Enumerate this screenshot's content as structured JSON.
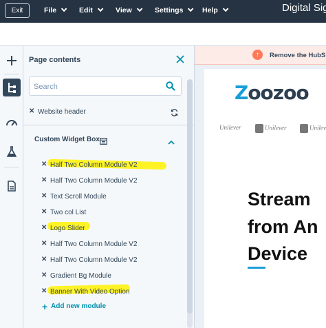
{
  "topbar": {
    "exit_label": "Exit",
    "menus": [
      "File",
      "Edit",
      "View",
      "Settings",
      "Help"
    ],
    "title": "Digital Sig"
  },
  "rail": {
    "icons": [
      "add-icon",
      "tree-icon",
      "gauge-icon",
      "flask-icon",
      "document-icon"
    ]
  },
  "panel": {
    "title": "Page contents",
    "search_placeholder": "Search",
    "header_item": "Website header",
    "group_title": "Custom Widget Box",
    "modules": [
      "Half Two Column Module V2",
      "Half Two Column Module V2",
      "Text Scroll Module",
      "Two col List",
      "Logo Slider",
      "Half Two Column Module V2",
      "Half Two Column Module V2",
      "Gradient Bg Module",
      "Banner With Video Option"
    ],
    "add_label": "Add new module",
    "highlight_color": "#fff200"
  },
  "preview": {
    "banner_text": "Remove the HubS",
    "logo_text": "oozoo",
    "logo_z": "Z",
    "brands": [
      "Unilever",
      "Unilever",
      "Unilever"
    ],
    "headline": [
      "Stream",
      "from An",
      "Device"
    ],
    "accent_color": "#1a9ed8"
  }
}
